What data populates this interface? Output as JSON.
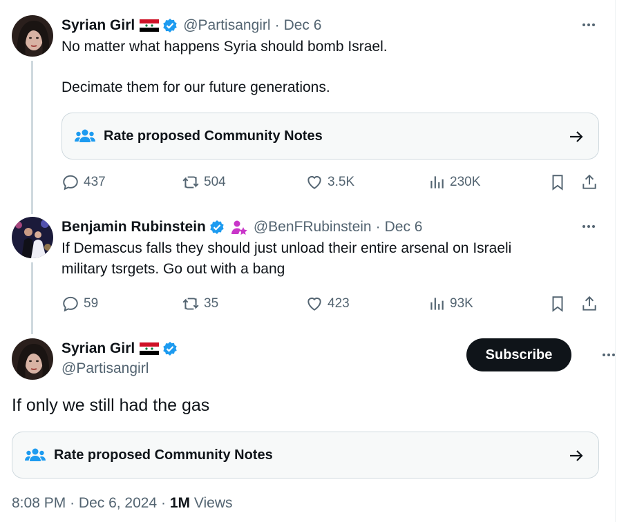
{
  "tweet1": {
    "name": "Syrian Girl",
    "handle": "@Partisangirl",
    "sep": "·",
    "date": "Dec 6",
    "line1": "No matter what happens Syria should bomb Israel.",
    "line2": "Decimate them for our future generations.",
    "notes_label": "Rate proposed Community Notes",
    "replies": "437",
    "reposts": "504",
    "likes": "3.5K",
    "views": "230K"
  },
  "tweet2": {
    "name": "Benjamin Rubinstein",
    "handle": "@BenFRubinstein",
    "sep": "·",
    "date": "Dec 6",
    "line1": "If Demascus falls they should just unload their entire arsenal on Israeli",
    "line2": "military tsrgets. Go out with a bang",
    "replies": "59",
    "reposts": "35",
    "likes": "423",
    "views": "93K"
  },
  "main": {
    "name": "Syrian Girl",
    "handle": "@Partisangirl",
    "subscribe_label": "Subscribe",
    "text": "If only we still had the gas",
    "notes_label": "Rate proposed Community Notes",
    "time": "8:08 PM",
    "date": "Dec 6, 2024",
    "sep": "·",
    "views_count": "1M",
    "views_label": "Views"
  },
  "colors": {
    "verified": "#1d9bf0",
    "muted": "#536471",
    "notes_icon": "#1d9bf0",
    "subscription_badge": "#c936c9"
  },
  "icons": [
    "syria-flag-icon",
    "verified-badge-icon",
    "more-icon",
    "community-notes-icon",
    "arrow-right-icon",
    "reply-icon",
    "repost-icon",
    "like-icon",
    "views-icon",
    "bookmark-icon",
    "share-icon",
    "subscriber-badge-icon"
  ]
}
